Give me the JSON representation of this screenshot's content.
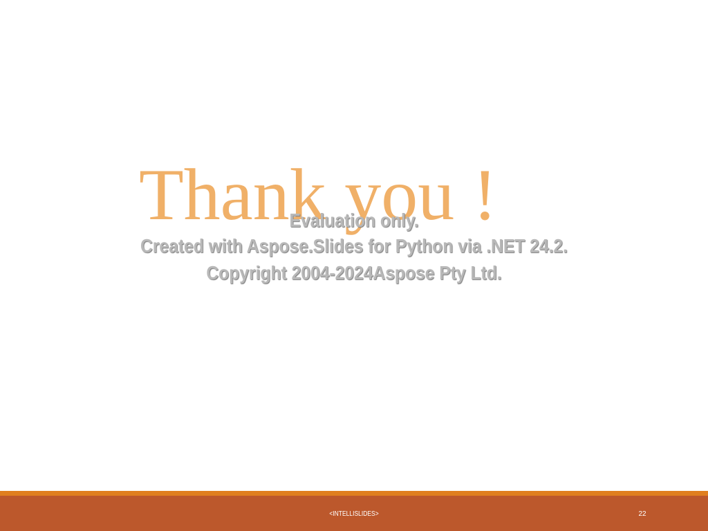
{
  "slide": {
    "title": "Thank you !",
    "watermark": {
      "line1": "Evaluation only.",
      "line2": "Created with Aspose.Slides for Python via .NET 24.2.",
      "line3": "Copyright 2004-2024Aspose Pty Ltd."
    },
    "footer": {
      "center_text": "<INTELLISLIDES>",
      "page_number": "22"
    }
  },
  "colors": {
    "title": "#f0b068",
    "footer_bar": "#bc582c",
    "accent_stripe": "#e07f1f",
    "watermark": "#b8b8b8"
  }
}
